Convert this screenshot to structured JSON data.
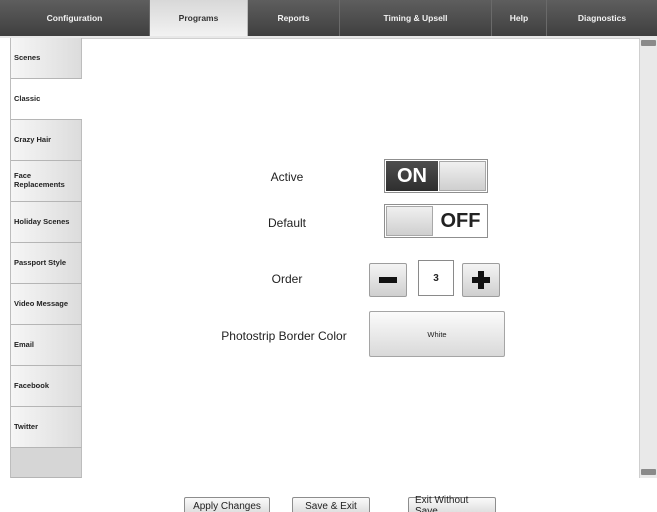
{
  "top_tabs": [
    "Configuration",
    "Programs",
    "Reports",
    "Timing & Upsell",
    "Help",
    "Diagnostics"
  ],
  "side_tabs": [
    "Scenes",
    "Classic",
    "Crazy Hair",
    "Face Replacements",
    "Holiday Scenes",
    "Passport Style",
    "Video Message",
    "Email",
    "Facebook",
    "Twitter"
  ],
  "active_top_tab": "Programs",
  "active_side_tab": "Classic",
  "settings": {
    "active_label": "Active",
    "active_state": "ON",
    "default_label": "Default",
    "default_state": "OFF",
    "order_label": "Order",
    "order_value": "3",
    "border_color_label": "Photostrip Border Color",
    "border_color_value": "White"
  },
  "bottom_buttons": {
    "apply": "Apply Changes",
    "save_exit": "Save & Exit",
    "exit_no_save": "Exit Without Save"
  },
  "icons": {
    "minus": "minus-icon",
    "plus": "plus-icon"
  },
  "colors": {
    "toolbar_dark": "#4a4a4a",
    "toggle_dark": "#3a3a3a",
    "active_tab": "#f2f2f2"
  }
}
